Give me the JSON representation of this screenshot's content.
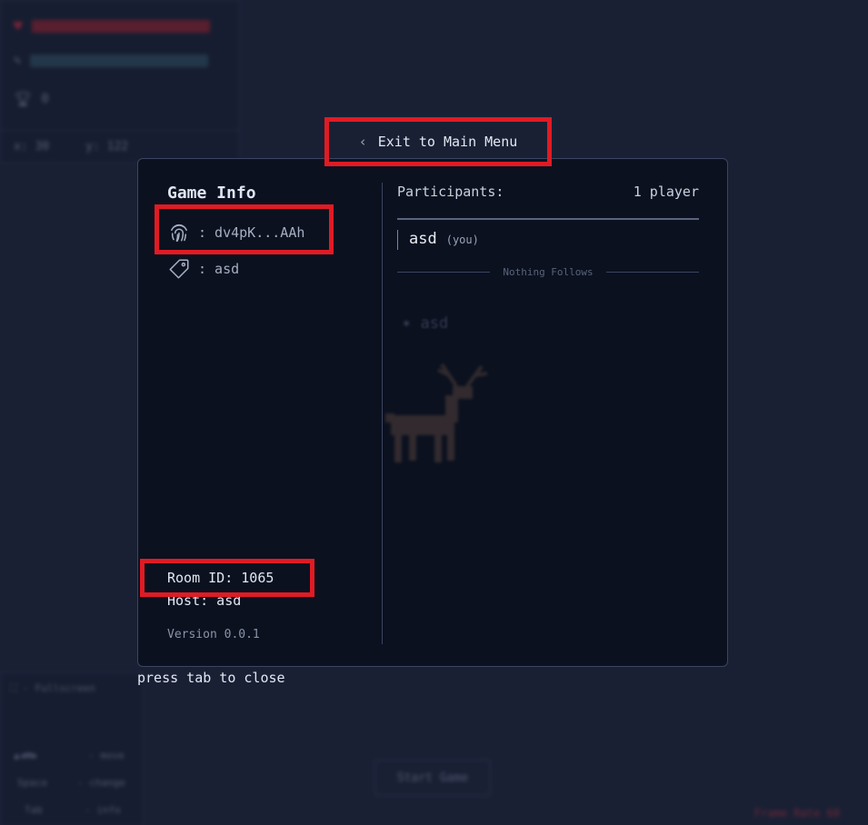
{
  "hud": {
    "health_value": "100",
    "stamina_value": "",
    "trophy_count": "0",
    "coord_x": "x: 30",
    "coord_y": "y: 122",
    "fullscreen_label": "- Fullscreen",
    "move_label": "- move",
    "space_key": "Space",
    "change_label": "- change",
    "tab_key": "Tab",
    "info_label": "- info",
    "start_button": "Start Game",
    "fps_label": "Frame Rate 60"
  },
  "exit_button": {
    "label": "Exit to Main Menu"
  },
  "game_info": {
    "title": "Game Info",
    "fingerprint": ": dv4pK...AAh",
    "tag": ": asd",
    "room_id": "Room ID: 1065",
    "host": "Host: asd",
    "version": "Version 0.0.1"
  },
  "participants": {
    "heading": "Participants:",
    "count": "1 player",
    "players": [
      {
        "name": "asd",
        "suffix": "(you)"
      }
    ],
    "end_label": "Nothing Follows"
  },
  "close_hint": "press tab to close",
  "colors": {
    "highlight": "#e01b24",
    "background": "#1a2034",
    "modal": "#0b101e"
  }
}
